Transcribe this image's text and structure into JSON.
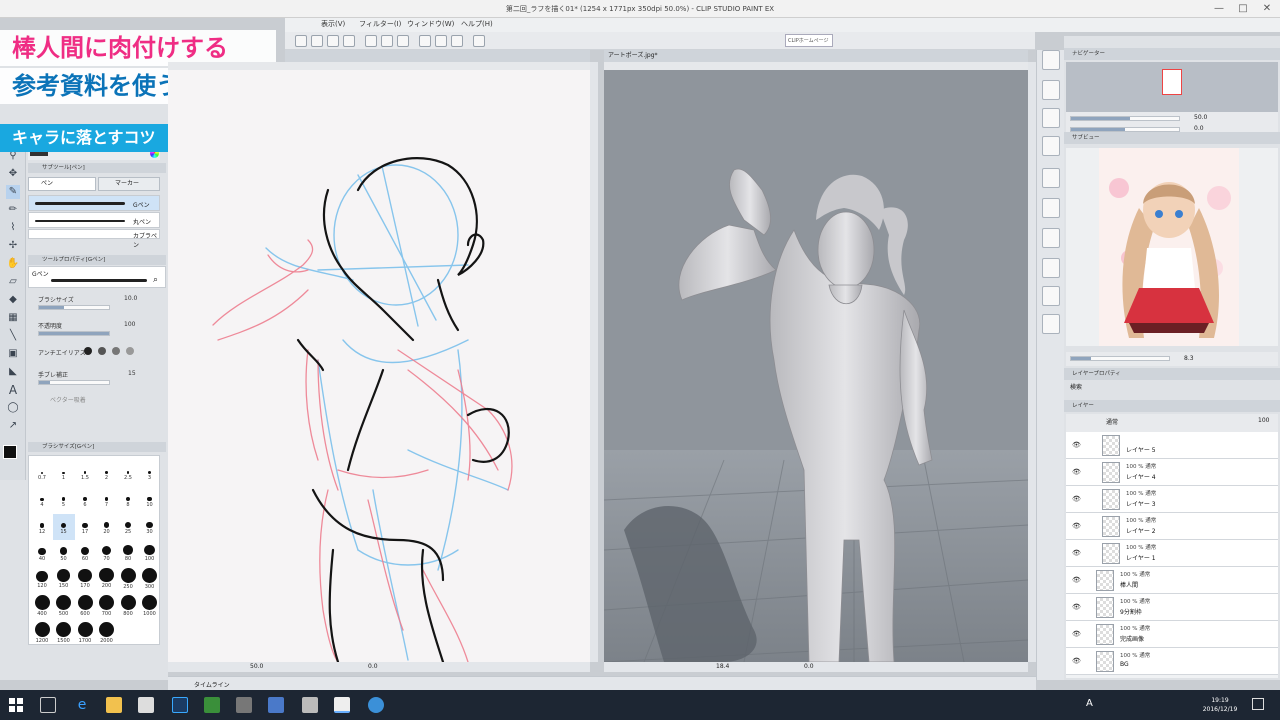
{
  "window": {
    "title": "第二回_ラフを描く01* (1254 x 1771px 350dpi 50.0%) - CLIP STUDIO PAINT EX",
    "controls": [
      "—",
      "□",
      "✕"
    ]
  },
  "overlay": {
    "line1": "棒人間に肉付けする",
    "line2": "参考資料を使う",
    "line3": "キャラに落とすコツ"
  },
  "menu": {
    "items": [
      "表示(V)",
      "フィルター(I)",
      "ウィンドウ(W)",
      "ヘルプ(H)"
    ],
    "homepage_button": "CLIPホームページ"
  },
  "canvas_left": {
    "zoom": "50.0",
    "angle": "0.0"
  },
  "canvas_right": {
    "tab": "アートポーズ.jpg*",
    "zoom": "18.4",
    "angle": "0.0"
  },
  "left_panel": {
    "sub_tool_header": "サブツール[ペン]",
    "tabs": [
      "ペン",
      "マーカー"
    ],
    "brushes": [
      "Gペン",
      "丸ペン",
      "カブラペン"
    ],
    "tool_property_header": "ツールプロパティ[Gペン]",
    "tool_property_name": "Gペン",
    "props": [
      {
        "label": "ブラシサイズ",
        "value": "10.0",
        "fill": 0.35
      },
      {
        "label": "不透明度",
        "value": "100",
        "fill": 1.0
      },
      {
        "label": "アンチエイリアス",
        "value": "",
        "fill": 0
      },
      {
        "label": "手ブレ補正",
        "value": "15",
        "fill": 0.15
      },
      {
        "label": "ベクター吸着",
        "value": "",
        "fill": 0
      }
    ],
    "brush_size_header": "ブラシサイズ[Gペン]",
    "brush_sizes": [
      "0.7",
      "1",
      "1.5",
      "2",
      "2.5",
      "3",
      "4",
      "5",
      "6",
      "7",
      "8",
      "10",
      "12",
      "15",
      "17",
      "20",
      "25",
      "30",
      "40",
      "50",
      "60",
      "70",
      "80",
      "100",
      "120",
      "150",
      "170",
      "200",
      "250",
      "300",
      "400",
      "500",
      "600",
      "700",
      "800",
      "1000",
      "1200",
      "1500",
      "1700",
      "2000"
    ]
  },
  "right_panel": {
    "navigator_header": "ナビゲーター",
    "navigator_zoom": "50.0",
    "navigator_angle": "0.0",
    "subview_header": "サブビュー",
    "subview_zoom": "8.3",
    "layer_property_header": "レイヤープロパティ",
    "layer_property_sub": "検索",
    "layer_header": "レイヤー",
    "blend_mode": "通常",
    "opacity": "100",
    "layers": [
      {
        "mode": "",
        "name": "レイヤー 5"
      },
      {
        "mode": "100 % 通常",
        "name": "レイヤー 4"
      },
      {
        "mode": "100 % 通常",
        "name": "レイヤー 3"
      },
      {
        "mode": "100 % 通常",
        "name": "レイヤー 2"
      },
      {
        "mode": "100 % 通常",
        "name": "レイヤー 1"
      },
      {
        "mode": "100 % 通常",
        "name": "棒人間"
      },
      {
        "mode": "100 % 通常",
        "name": "9分割枠"
      },
      {
        "mode": "100 % 通常",
        "name": "完成画像"
      },
      {
        "mode": "100 % 通常",
        "name": "BG"
      }
    ]
  },
  "timeline": {
    "label": "タイムライン"
  },
  "taskbar": {
    "time": "19:19",
    "date": "2016/12/19",
    "tray": "A"
  },
  "colors": {
    "accent_pink": "#ef2d84",
    "accent_blue": "#0b73b8",
    "banner_cyan": "#19a8e0",
    "sketch_pink": "#ee7f90",
    "sketch_blue": "#7cc0ec"
  }
}
